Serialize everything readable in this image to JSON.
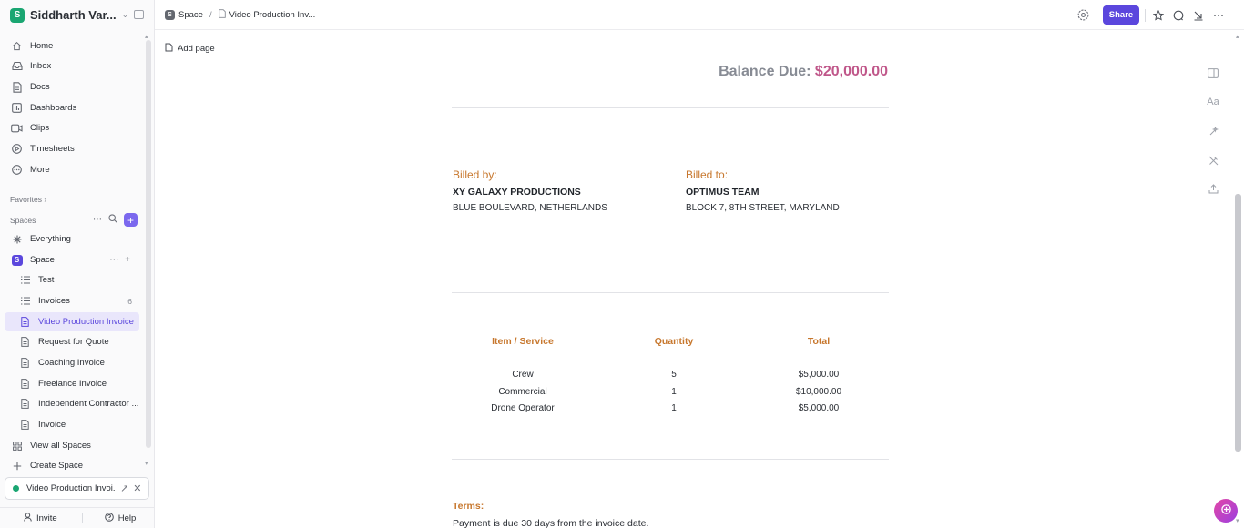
{
  "workspace": {
    "avatar": "S",
    "name": "Siddharth Var..."
  },
  "nav": [
    {
      "label": "Home",
      "icon": "home-icon"
    },
    {
      "label": "Inbox",
      "icon": "inbox-icon"
    },
    {
      "label": "Docs",
      "icon": "docs-icon"
    },
    {
      "label": "Dashboards",
      "icon": "dashboards-icon"
    },
    {
      "label": "Clips",
      "icon": "clips-icon"
    },
    {
      "label": "Timesheets",
      "icon": "timesheets-icon"
    },
    {
      "label": "More",
      "icon": "more-icon"
    }
  ],
  "favorites_label": "Favorites",
  "spaces_label": "Spaces",
  "everything_label": "Everything",
  "space": {
    "avatar": "S",
    "name": "Space"
  },
  "space_items": [
    {
      "label": "Test",
      "icon": "list-icon"
    },
    {
      "label": "Invoices",
      "icon": "list-icon",
      "count": "6"
    },
    {
      "label": "Video Production Invoice",
      "icon": "doc-icon",
      "active": true
    },
    {
      "label": "Request for Quote",
      "icon": "doc-icon"
    },
    {
      "label": "Coaching Invoice",
      "icon": "doc-icon"
    },
    {
      "label": "Freelance Invoice",
      "icon": "doc-icon"
    },
    {
      "label": "Independent Contractor ...",
      "icon": "doc-icon"
    },
    {
      "label": "Invoice",
      "icon": "doc-icon"
    }
  ],
  "view_all_spaces": "View all Spaces",
  "create_space": "Create Space",
  "pinned_doc": "Video Production Invoi...",
  "bottom": {
    "invite": "Invite",
    "help": "Help"
  },
  "breadcrumb": {
    "space": "Space",
    "separator": "/",
    "doc": "Video Production Inv..."
  },
  "share_label": "Share",
  "add_page": "Add page",
  "balance": {
    "label": "Balance Due:",
    "amount": "$20,000.00"
  },
  "billed_by": {
    "label": "Billed by:",
    "name": "XY GALAXY PRODUCTIONS",
    "address": "BLUE BOULEVARD, NETHERLANDS"
  },
  "billed_to": {
    "label": "Billed to:",
    "name": "OPTIMUS TEAM",
    "address": "BLOCK 7, 8TH STREET, MARYLAND"
  },
  "table": {
    "headers": [
      "Item / Service",
      "Quantity",
      "Total"
    ],
    "rows": [
      [
        "Crew",
        "5",
        "$5,000.00"
      ],
      [
        "Commercial",
        "1",
        "$10,000.00"
      ],
      [
        "Drone Operator",
        "1",
        "$5,000.00"
      ]
    ]
  },
  "terms": {
    "label": "Terms:",
    "text": "Payment is due 30 days from the invoice date."
  },
  "colors": {
    "accent": "#5b47dd",
    "orange": "#c7772d",
    "pink": "#c0578a",
    "green": "#1aa672"
  }
}
